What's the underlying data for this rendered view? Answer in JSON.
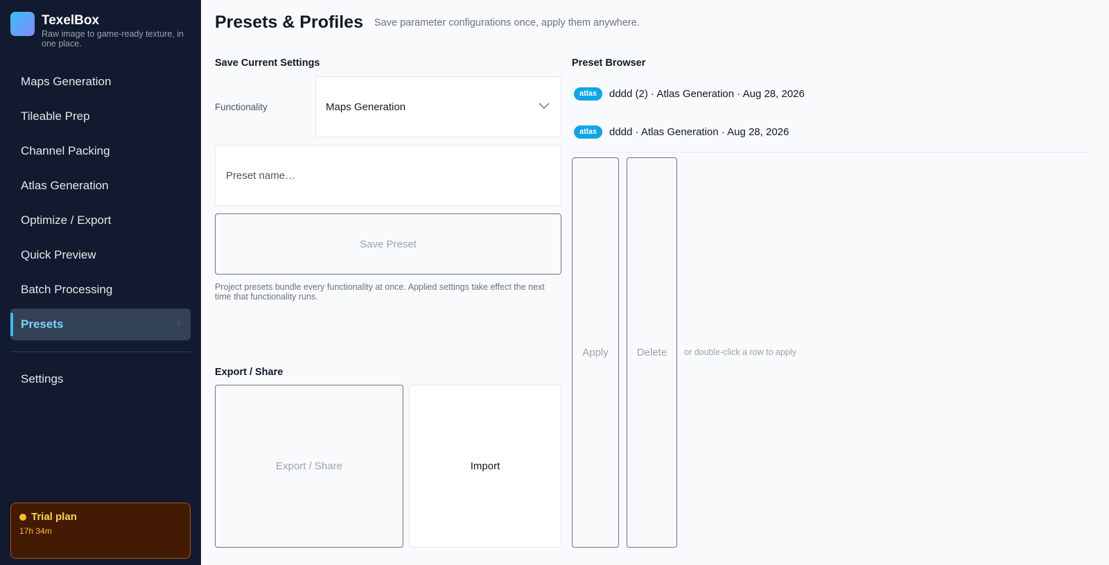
{
  "app": {
    "name": "TexelBox",
    "tagline": "Raw image to game-ready texture, in one place."
  },
  "sidebar": {
    "items": [
      {
        "label": "Maps Generation"
      },
      {
        "label": "Tileable Prep"
      },
      {
        "label": "Channel Packing"
      },
      {
        "label": "Atlas Generation"
      },
      {
        "label": "Optimize / Export"
      },
      {
        "label": "Quick Preview"
      },
      {
        "label": "Batch Processing"
      },
      {
        "label": "Presets",
        "badge": "8",
        "active": true
      }
    ],
    "settings_label": "Settings",
    "trial": {
      "title": "Trial plan",
      "remaining": "17h 34m"
    }
  },
  "header": {
    "title": "Presets & Profiles",
    "subtitle": "Save parameter configurations once, apply them anywhere."
  },
  "save_section": {
    "title": "Save Current Settings",
    "functionality_label": "Functionality",
    "functionality_value": "Maps Generation",
    "name_placeholder": "Preset name…",
    "save_label": "Save Preset",
    "helper_text": "Project presets bundle every functionality at once. Applied settings take effect the next time that functionality runs."
  },
  "export_section": {
    "title": "Export / Share",
    "export_label": "Export / Share",
    "import_label": "Import"
  },
  "browser": {
    "title": "Preset Browser",
    "presets": [
      {
        "tag": "atlas",
        "text": "dddd (2) · Atlas Generation · Aug 28, 2026"
      },
      {
        "tag": "atlas",
        "text": "dddd · Atlas Generation · Aug 28, 2026"
      }
    ],
    "apply_label": "Apply",
    "delete_label": "Delete",
    "hint": "or double-click a row to apply"
  },
  "colors": {
    "sidebar_bg": "#111a2e",
    "accent": "#38bdf8",
    "badge": "#0ea5e9",
    "trial_bg": "#431a04",
    "trial_accent": "#fbbf24"
  }
}
